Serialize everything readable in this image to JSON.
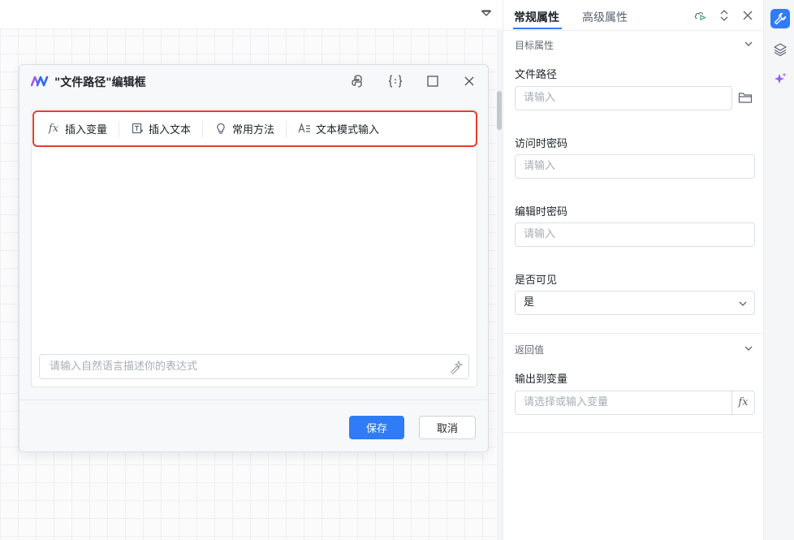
{
  "dialog": {
    "title": "\"文件路径\"编辑框",
    "toolbar": {
      "insert_variable": "插入变量",
      "insert_text": "插入文本",
      "common_methods": "常用方法",
      "text_mode_input": "文本模式输入",
      "fx_glyph": "fx"
    },
    "nl_placeholder": "请输入自然语言描述你的表达式",
    "save_label": "保存",
    "cancel_label": "取消",
    "header_icons": [
      "python-icon",
      "braces-icon",
      "maximize-icon",
      "close-icon"
    ]
  },
  "panel": {
    "tabs": {
      "general": "常规属性",
      "advanced": "高级属性"
    },
    "target_section": "目标属性",
    "file_path": {
      "label": "文件路径",
      "placeholder": "请输入"
    },
    "open_password": {
      "label": "访问时密码",
      "placeholder": "请输入"
    },
    "edit_password": {
      "label": "编辑时密码",
      "placeholder": "请输入"
    },
    "visible": {
      "label": "是否可见",
      "value": "是"
    },
    "return_section": "返回值",
    "output_var": {
      "label": "输出到变量",
      "placeholder": "请选择或输入变量",
      "fx_glyph": "fx"
    }
  },
  "colors": {
    "accent": "#2f7cf6",
    "highlight": "#e1412b"
  }
}
